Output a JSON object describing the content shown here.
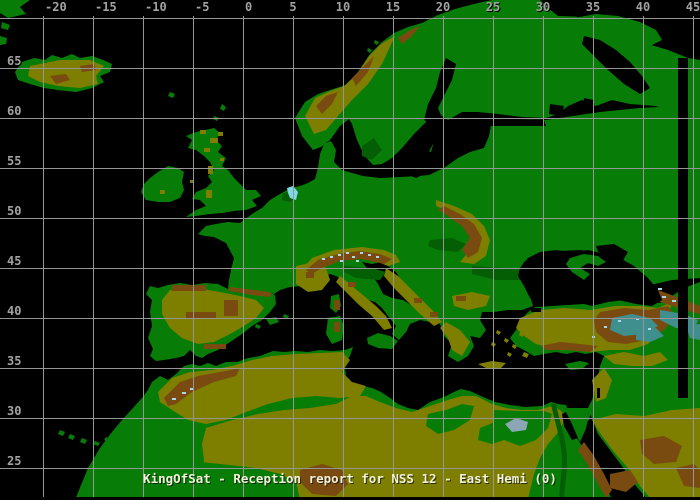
{
  "map": {
    "caption": "KingOfSat - Reception report for NSS 12 - East Hemi (0)",
    "axes": {
      "lon_ticks": [
        "-20",
        "-15",
        "-10",
        "-5",
        "0",
        "5",
        "10",
        "15",
        "20",
        "25",
        "30",
        "35",
        "40",
        "45"
      ],
      "lat_ticks": [
        "65",
        "60",
        "55",
        "50",
        "45",
        "40",
        "35",
        "30",
        "25"
      ]
    },
    "palette": {
      "sea": "#000000",
      "lowland_green": "#077d07",
      "valley_dark_green": "#045f04",
      "plateau_olive": "#7e7e00",
      "mountain_brown": "#7a4b10",
      "high_plateau_teal": "#3f8f8f",
      "depression_slate": "#8ca6b6",
      "snow_light_blue": "#a8d8ee",
      "lake_cyan": "#7fd8e8",
      "grid_line": "#969696",
      "tick_label": "#a2a2a2",
      "caption_text": "#f2f2da"
    }
  }
}
